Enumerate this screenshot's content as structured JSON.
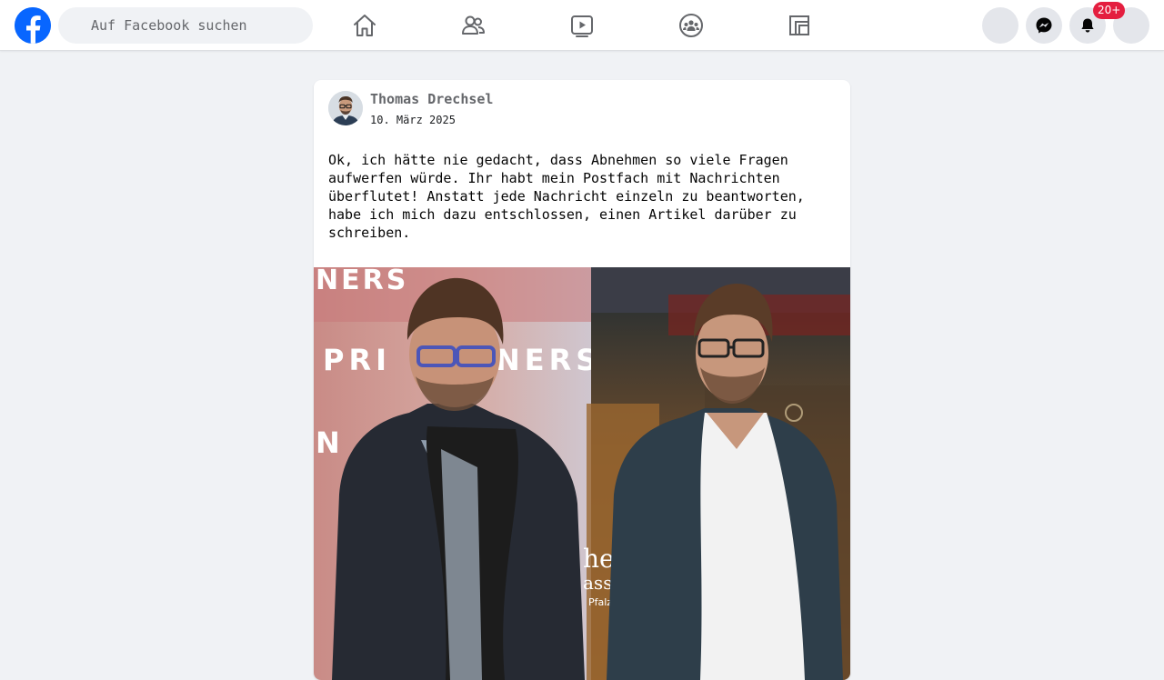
{
  "header": {
    "search_placeholder": "Auf Facebook suchen",
    "nav_icons": [
      "home-icon",
      "friends-icon",
      "watch-icon",
      "groups-icon",
      "gaming-icon"
    ],
    "notification_count": "20+",
    "colors": {
      "brand": "#0866ff",
      "badge": "#e41e3f",
      "icon": "#65676b"
    }
  },
  "post": {
    "author": "Thomas Drechsel",
    "date": "10. März 2025",
    "text": "Ok, ich hätte nie gedacht, dass Abnehmen so viele Fragen aufwerfen würde. Ihr habt mein Postfach mit Nachrichten überflutet! Anstatt jede Nachricht einzeln zu beantworten, habe ich mich dazu entschlossen, einen Artikel darüber zu schreiben.",
    "photo": {
      "backdrop_left_text": "NERS",
      "backdrop_left_text_2": "PRI",
      "backdrop_left_text_3": "NERS",
      "backdrop_left_text_4": "N",
      "backdrop_right_text_1": "he",
      "backdrop_right_text_2": "ass",
      "backdrop_right_text_3": "Pfalz."
    }
  }
}
